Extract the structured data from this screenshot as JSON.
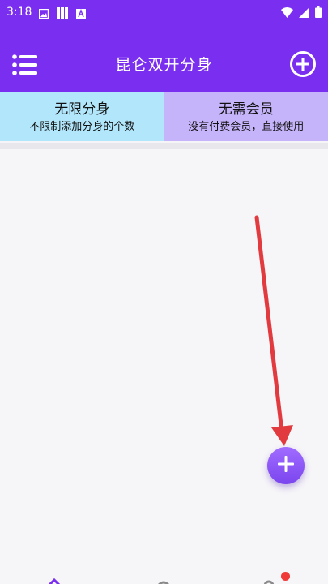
{
  "status_bar": {
    "time": "3:18",
    "icons": [
      "image-icon",
      "grid-icon",
      "text-a-icon",
      "wifi-icon",
      "signal-icon",
      "battery-icon"
    ]
  },
  "app_bar": {
    "title": "昆仑双开分身",
    "menu_icon": "list-menu-icon",
    "add_icon": "plus-circle-icon"
  },
  "banner": {
    "left": {
      "title": "无限分身",
      "subtitle": "不限制添加分身的个数"
    },
    "right": {
      "title": "无需会员",
      "subtitle": "没有付费会员，直接使用"
    }
  },
  "fab": {
    "icon": "plus-icon"
  },
  "bottom_nav": {
    "items": [
      "home-icon",
      "shield-icon",
      "person-icon"
    ],
    "badge": "notification-dot"
  },
  "colors": {
    "primary": "#7a2ff0",
    "banner_left": "#b2e6fb",
    "banner_right": "#c6b4fb",
    "arrow": "#e23b3f",
    "badge": "#f03a3a"
  }
}
